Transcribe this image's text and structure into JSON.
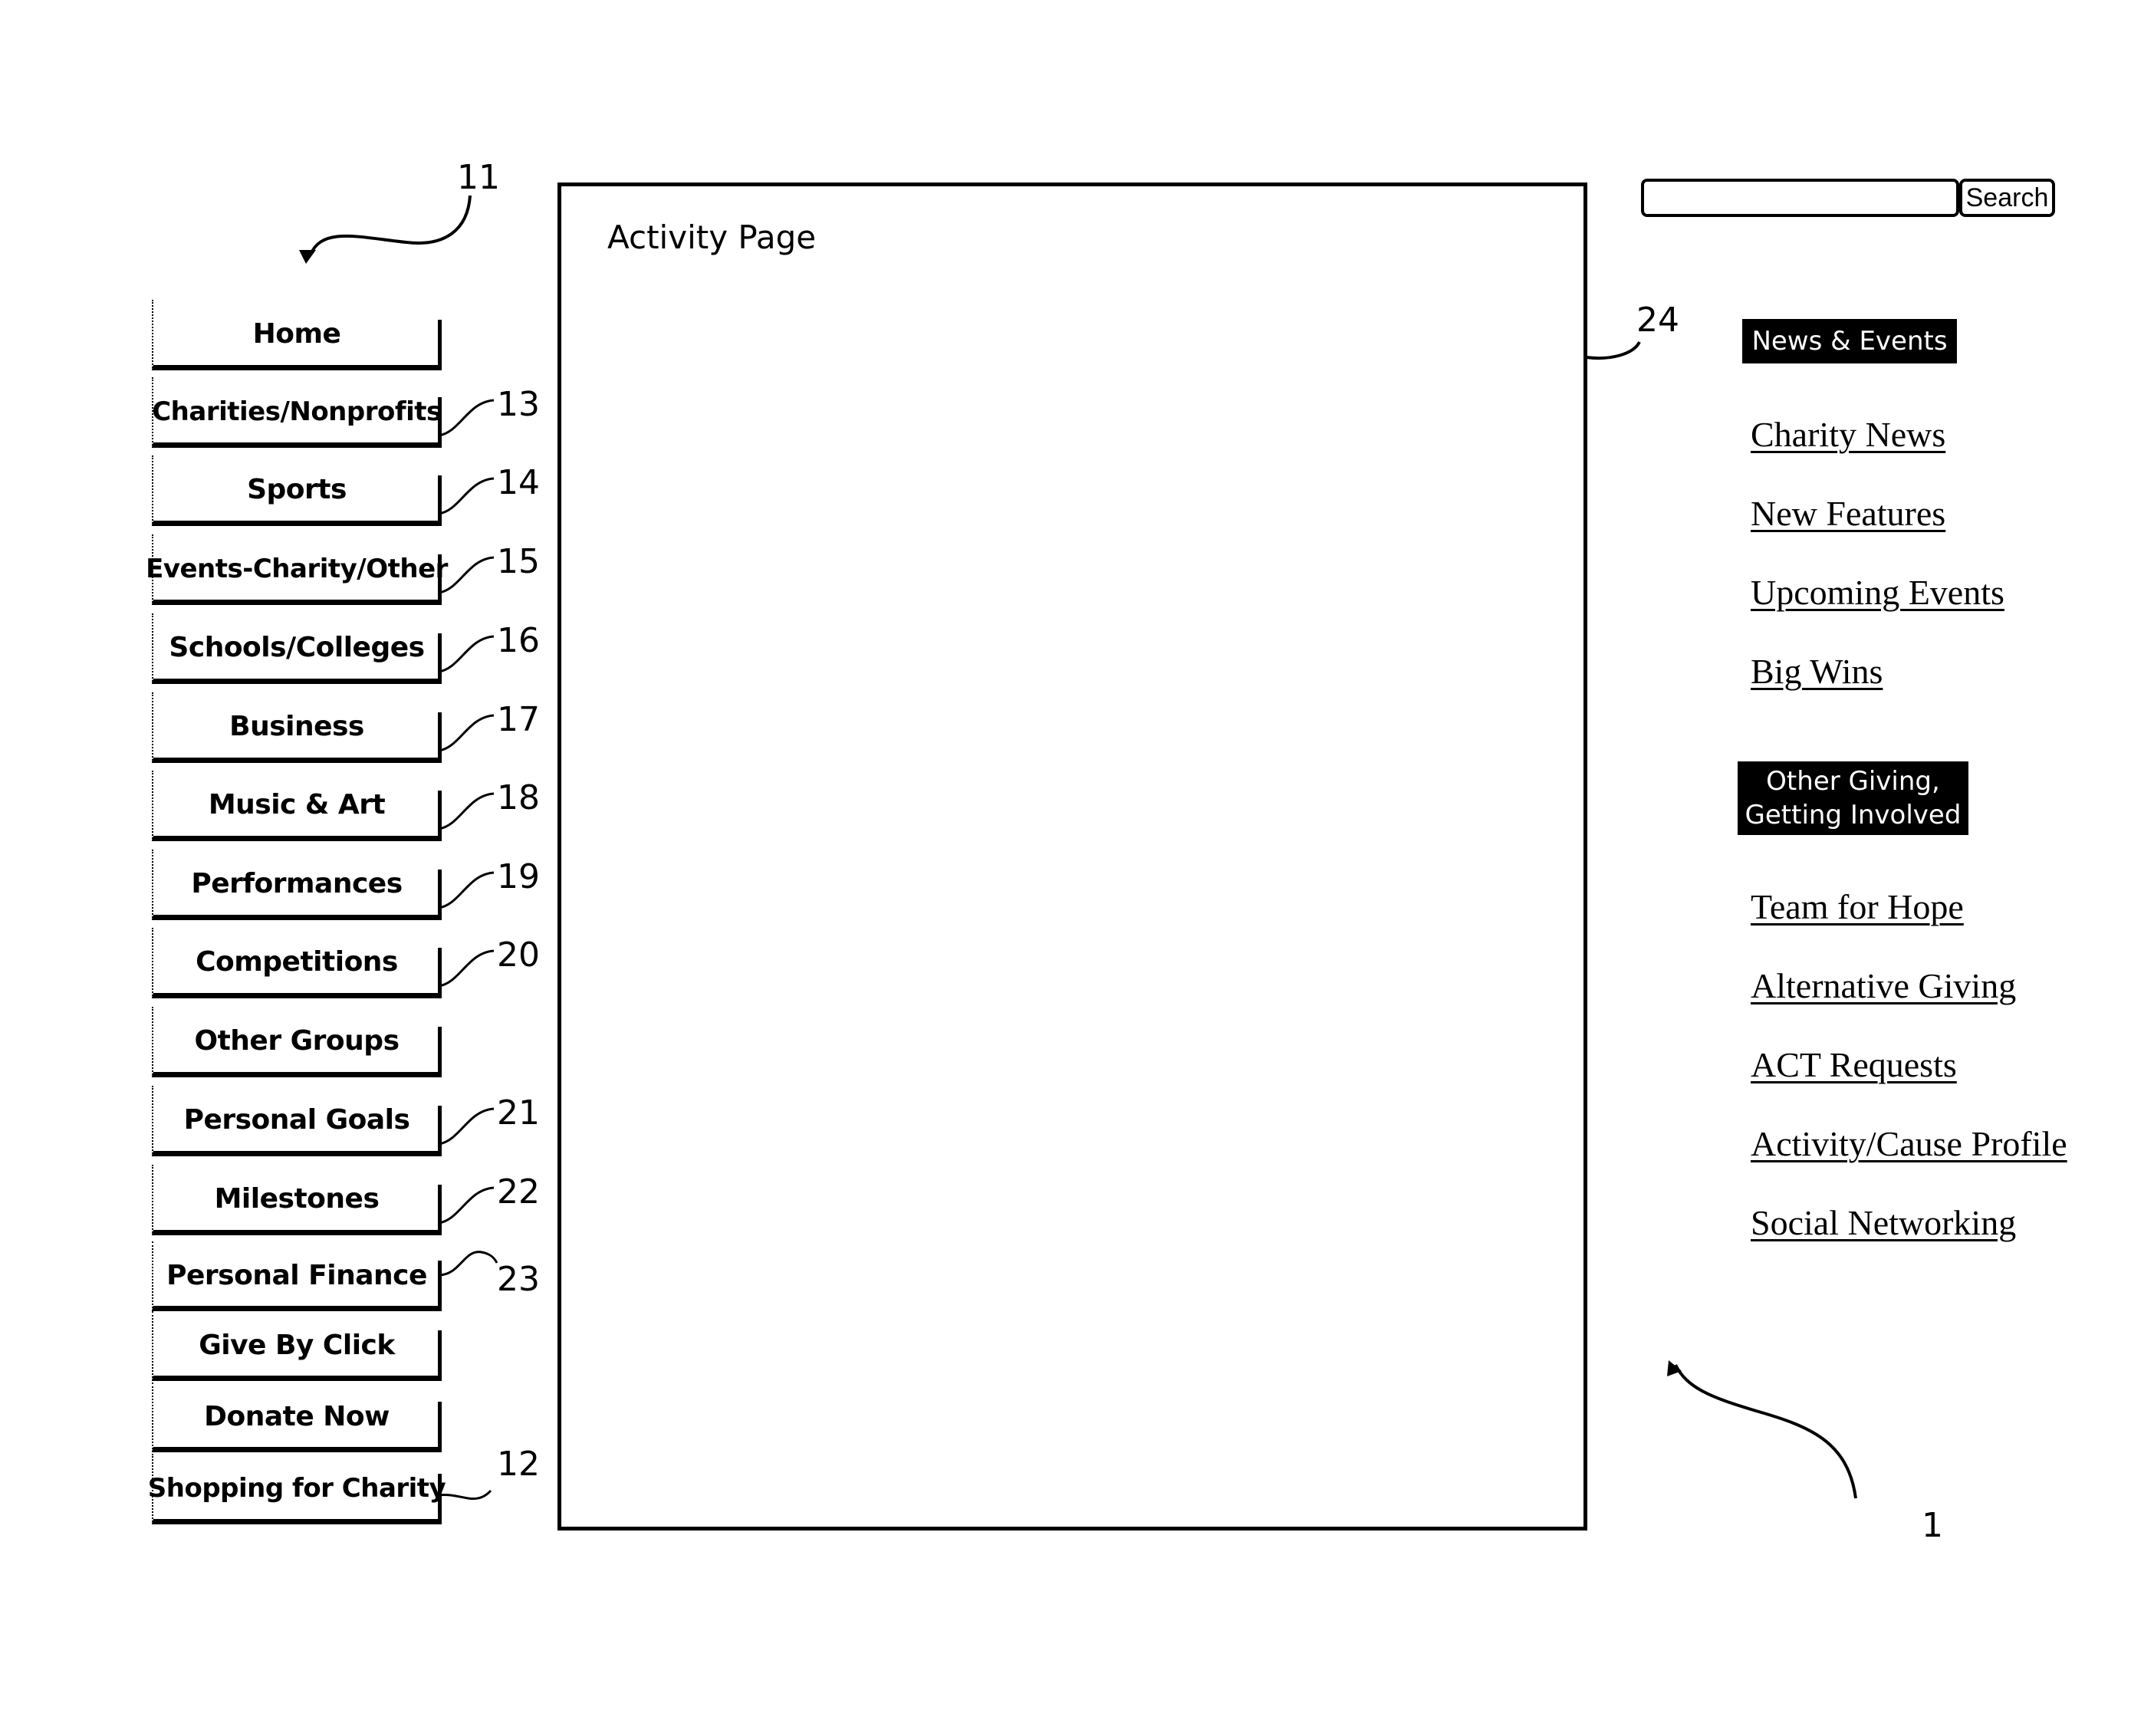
{
  "figure_refs": {
    "left_nav": "11",
    "main_panel": "24",
    "page": "1"
  },
  "search": {
    "input_value": "",
    "input_placeholder": "",
    "button_label": "Search"
  },
  "main_panel": {
    "title": "Activity Page"
  },
  "left_nav": {
    "items": [
      {
        "label": "Home",
        "ref": ""
      },
      {
        "label": "Charities/Nonprofits",
        "ref": "13"
      },
      {
        "label": "Sports",
        "ref": "14"
      },
      {
        "label": "Events-Charity/Other",
        "ref": "15"
      },
      {
        "label": "Schools/Colleges",
        "ref": "16"
      },
      {
        "label": "Business",
        "ref": "17"
      },
      {
        "label": "Music & Art",
        "ref": "18"
      },
      {
        "label": "Performances",
        "ref": "19"
      },
      {
        "label": "Competitions",
        "ref": "20"
      },
      {
        "label": "Other Groups",
        "ref": ""
      },
      {
        "label": "Personal Goals",
        "ref": "21"
      },
      {
        "label": "Milestones",
        "ref": "22"
      },
      {
        "label": "Personal Finance",
        "ref": "23"
      },
      {
        "label": "Give By Click",
        "ref": ""
      },
      {
        "label": "Donate Now",
        "ref": ""
      },
      {
        "label": "Shopping for Charity",
        "ref": "12"
      }
    ]
  },
  "right_sidebar": {
    "sections": [
      {
        "header": "News & Events",
        "links": [
          "Charity News",
          "New Features",
          "Upcoming Events",
          "Big Wins"
        ]
      },
      {
        "header_line1": "Other Giving,",
        "header_line2": "Getting Involved",
        "links": [
          "Team for Hope",
          "Alternative Giving",
          "ACT Requests",
          "Activity/Cause Profile",
          "Social Networking"
        ]
      }
    ]
  }
}
